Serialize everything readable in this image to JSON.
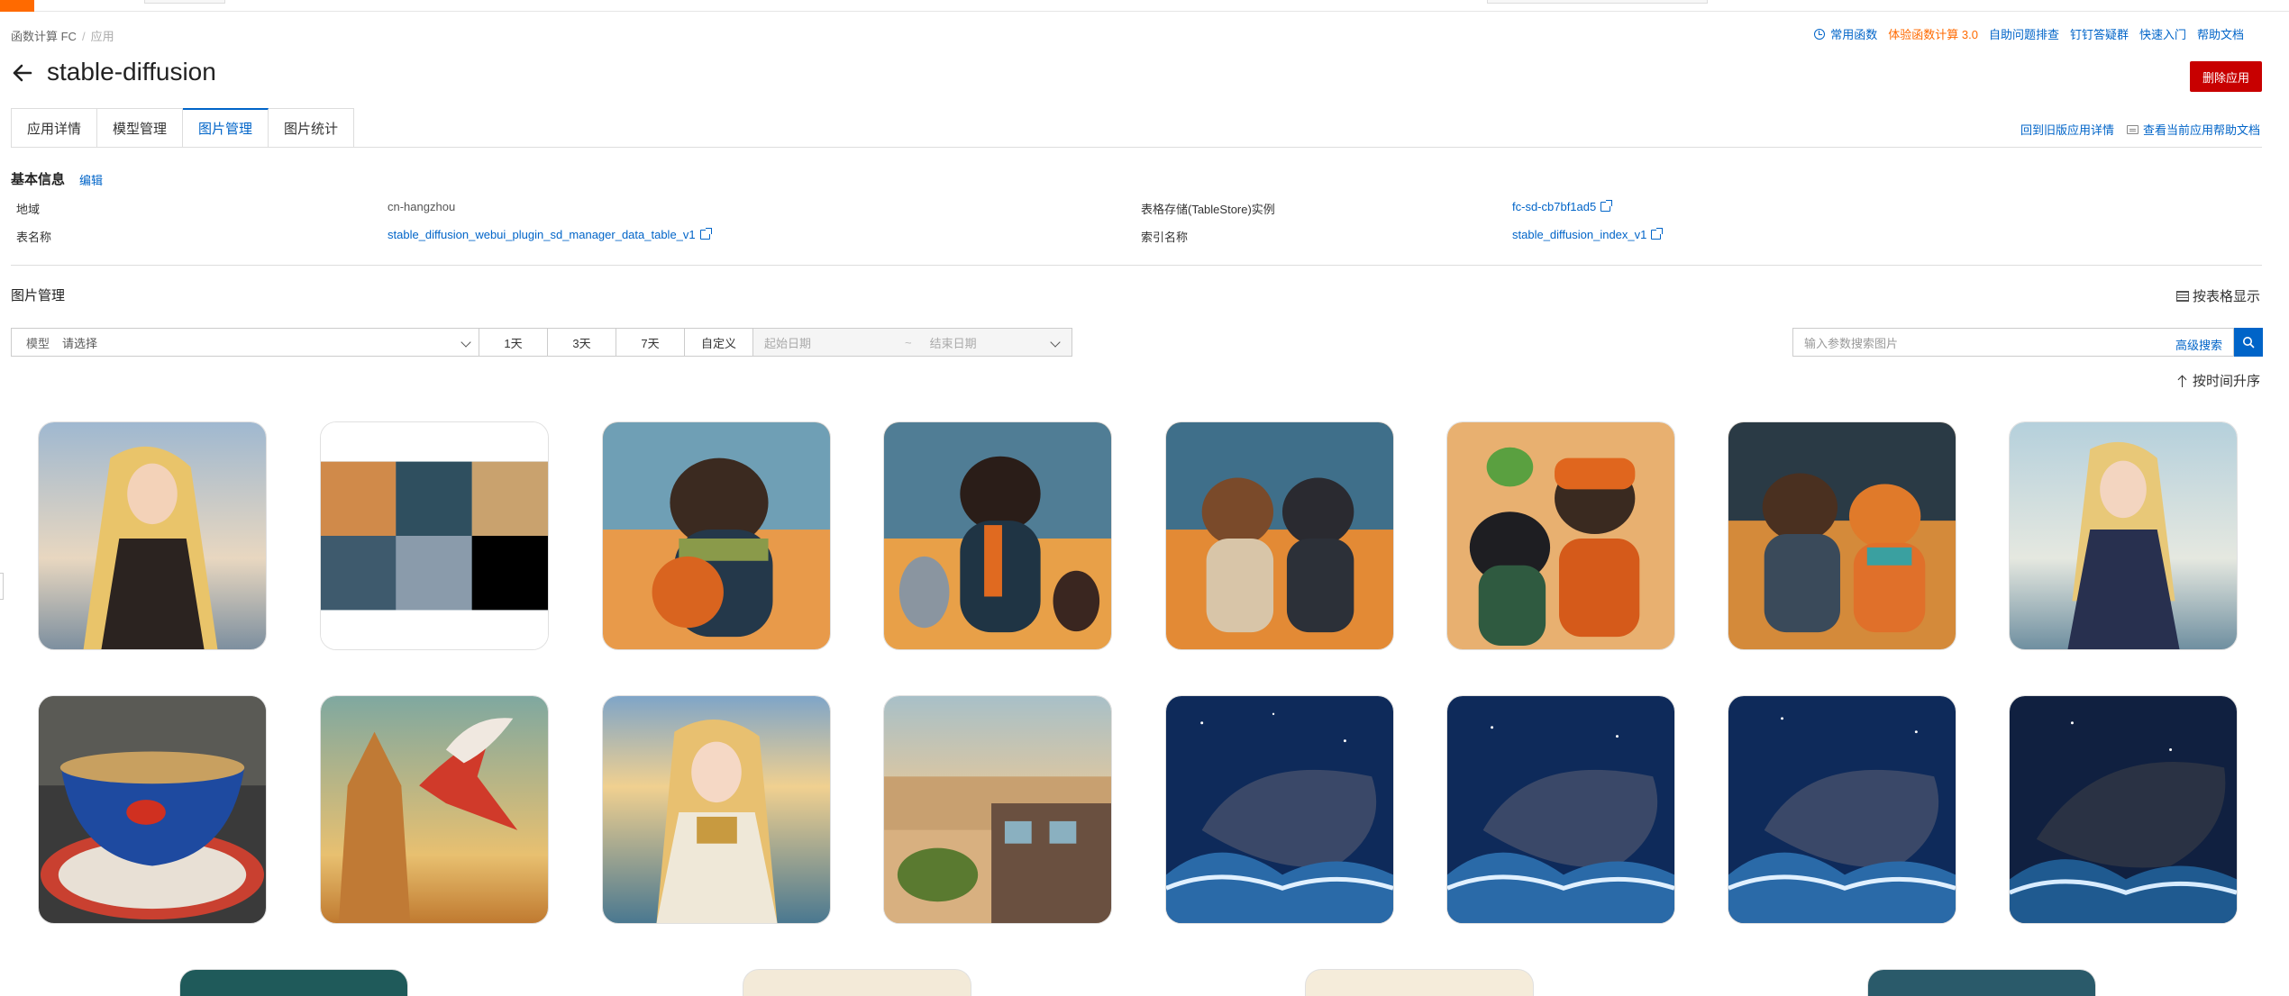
{
  "breadcrumb": {
    "root": "函数计算 FC",
    "current": "应用"
  },
  "top_links": {
    "common_functions": "常用函数",
    "try_fc3": "体验函数计算 3.0",
    "self_diagnosis": "自助问题排查",
    "dingtalk_group": "钉钉答疑群",
    "quick_start": "快速入门",
    "help_docs": "帮助文档"
  },
  "page": {
    "title": "stable-diffusion",
    "delete_button": "删除应用"
  },
  "tabs": [
    {
      "label": "应用详情"
    },
    {
      "label": "模型管理"
    },
    {
      "label": "图片管理"
    },
    {
      "label": "图片统计"
    }
  ],
  "tab_links": {
    "old_version": "回到旧版应用详情",
    "app_help": "查看当前应用帮助文档"
  },
  "basic_info": {
    "title": "基本信息",
    "edit": "编辑",
    "region_label": "地域",
    "region_value": "cn-hangzhou",
    "table_label": "表名称",
    "table_value": "stable_diffusion_webui_plugin_sd_manager_data_table_v1",
    "tablestore_label": "表格存储(TableStore)实例",
    "tablestore_value": "fc-sd-cb7bf1ad5",
    "index_label": "索引名称",
    "index_value": "stable_diffusion_index_v1"
  },
  "image_management": {
    "title": "图片管理",
    "table_view": "按表格显示",
    "model_label": "模型",
    "model_placeholder": "请选择",
    "ranges": [
      "1天",
      "3天",
      "7天",
      "自定义"
    ],
    "start_date_placeholder": "起始日期",
    "end_date_placeholder": "结束日期",
    "date_separator": "~",
    "search_placeholder": "输入参数搜索图片",
    "advanced_search": "高级搜索",
    "sort": "按时间升序"
  },
  "colors": {
    "accent": "#0064c8",
    "danger": "#c80000",
    "brand": "#ff6a00"
  },
  "icons": [
    "clock-icon",
    "back-arrow-icon",
    "external-link-icon",
    "doc-icon",
    "grid-icon",
    "search-icon",
    "up-arrow-icon",
    "chevron-down-icon"
  ]
}
